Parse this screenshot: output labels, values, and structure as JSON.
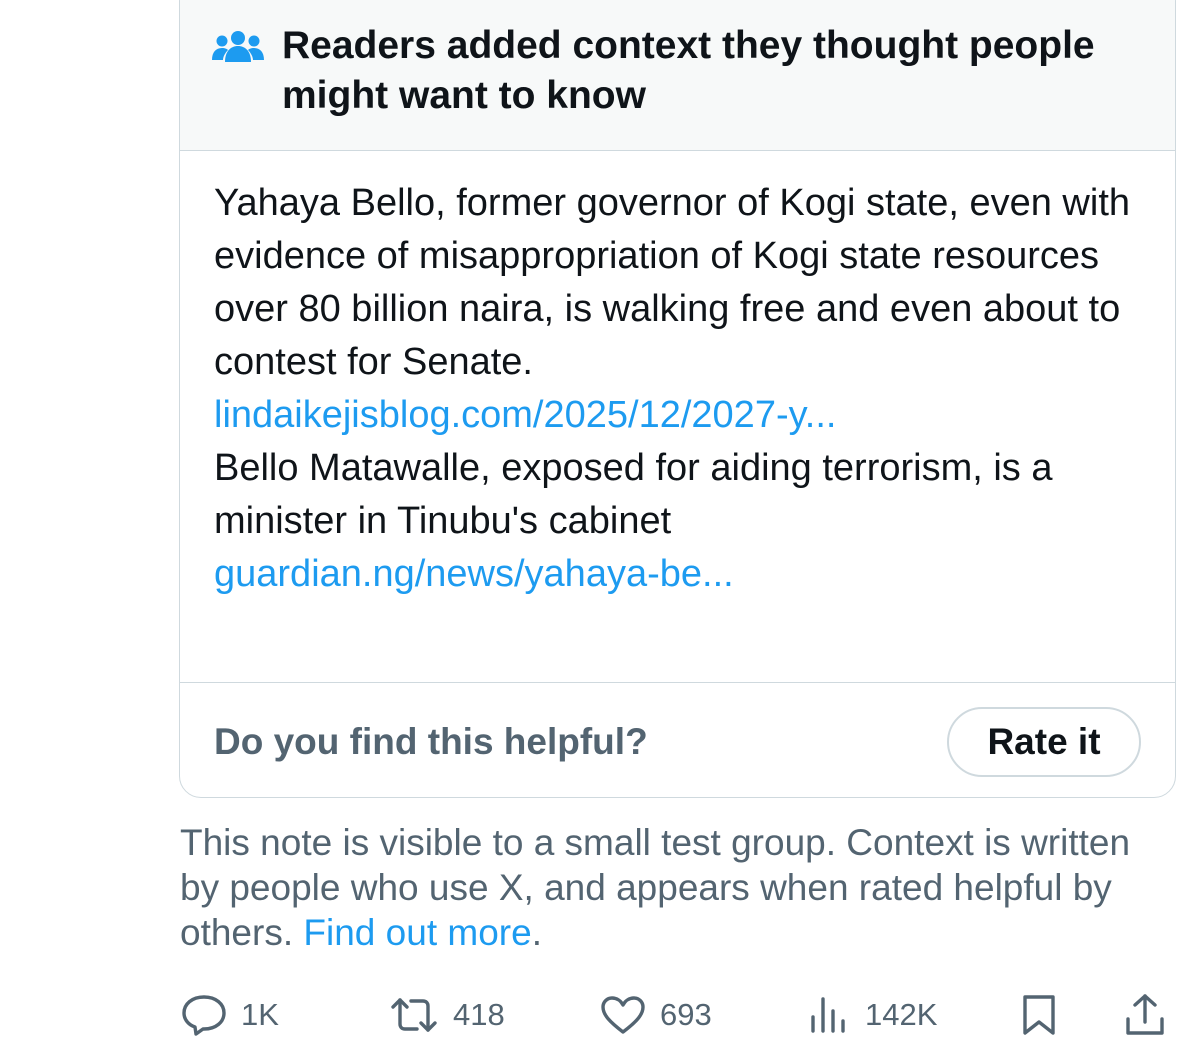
{
  "note": {
    "header_title": "Readers added context they thought people might want to know",
    "icon": "people-group-icon",
    "body": {
      "para1": "Yahaya Bello, former governor of Kogi state, even with evidence of misappropriation of Kogi state resources over 80 billion naira, is walking free and even about to contest for Senate.",
      "link1": "lindaikejisblog.com/2025/12/2027-y...",
      "para2": "Bello Matawalle, exposed for aiding terrorism, is a minister in Tinubu's cabinet",
      "link2": "guardian.ng/news/yahaya-be..."
    },
    "footer": {
      "question": "Do you find this helpful?",
      "rate_label": "Rate it"
    }
  },
  "footnote": {
    "text": "This note is visible to a small test group. Context is written by people who use X, and appears when rated helpful by others. ",
    "link": "Find out more",
    "trail": "."
  },
  "actions": {
    "replies": "1K",
    "reposts": "418",
    "likes": "693",
    "views": "142K"
  },
  "colors": {
    "accent": "#1d9bf0",
    "secondary_text": "#536471",
    "border": "#cfd9de",
    "header_bg": "#f7f9f9"
  }
}
